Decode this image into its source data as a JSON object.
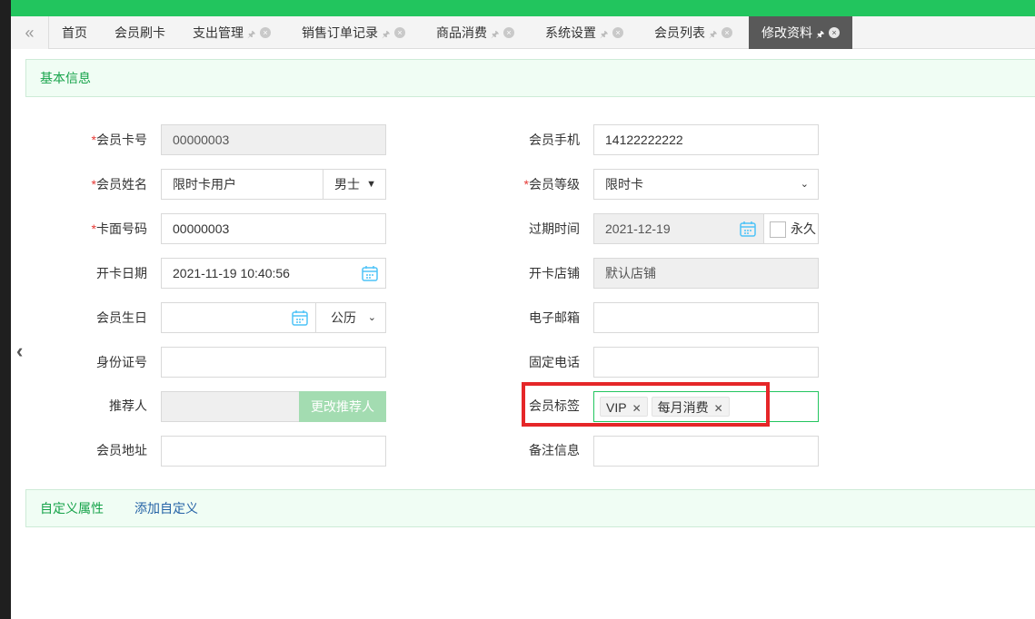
{
  "tabs": [
    {
      "label": "首页"
    },
    {
      "label": "会员刷卡"
    },
    {
      "label": "支出管理"
    },
    {
      "label": "销售订单记录"
    },
    {
      "label": "商品消费"
    },
    {
      "label": "系统设置"
    },
    {
      "label": "会员列表"
    },
    {
      "label": "修改资料"
    }
  ],
  "section_basic": "基本信息",
  "section_custom": {
    "title": "自定义属性",
    "add_link": "添加自定义"
  },
  "form": {
    "card_no": {
      "label": "会员卡号",
      "value": "00000003"
    },
    "phone": {
      "label": "会员手机",
      "value": "14122222222"
    },
    "name": {
      "label": "会员姓名",
      "value": "限时卡用户",
      "gender": "男士"
    },
    "level": {
      "label": "会员等级",
      "value": "限时卡"
    },
    "face_no": {
      "label": "卡面号码",
      "value": "00000003"
    },
    "expire": {
      "label": "过期时间",
      "value": "2021-12-19",
      "forever": "永久"
    },
    "open_date": {
      "label": "开卡日期",
      "value": "2021-11-19 10:40:56"
    },
    "open_store": {
      "label": "开卡店铺",
      "value": "默认店铺"
    },
    "birthday": {
      "label": "会员生日",
      "value": "",
      "calendar": "公历"
    },
    "email": {
      "label": "电子邮箱",
      "value": ""
    },
    "id_no": {
      "label": "身份证号",
      "value": ""
    },
    "tel": {
      "label": "固定电话",
      "value": ""
    },
    "referrer": {
      "label": "推荐人",
      "value": "",
      "button": "更改推荐人"
    },
    "tags": {
      "label": "会员标签",
      "items": [
        "VIP",
        "每月消费"
      ]
    },
    "address": {
      "label": "会员地址",
      "value": ""
    },
    "remark": {
      "label": "备注信息",
      "value": ""
    }
  },
  "required_mark": "*",
  "colors": {
    "accent": "#22c55e",
    "highlight": "#e52628",
    "active_tab": "#595959"
  }
}
